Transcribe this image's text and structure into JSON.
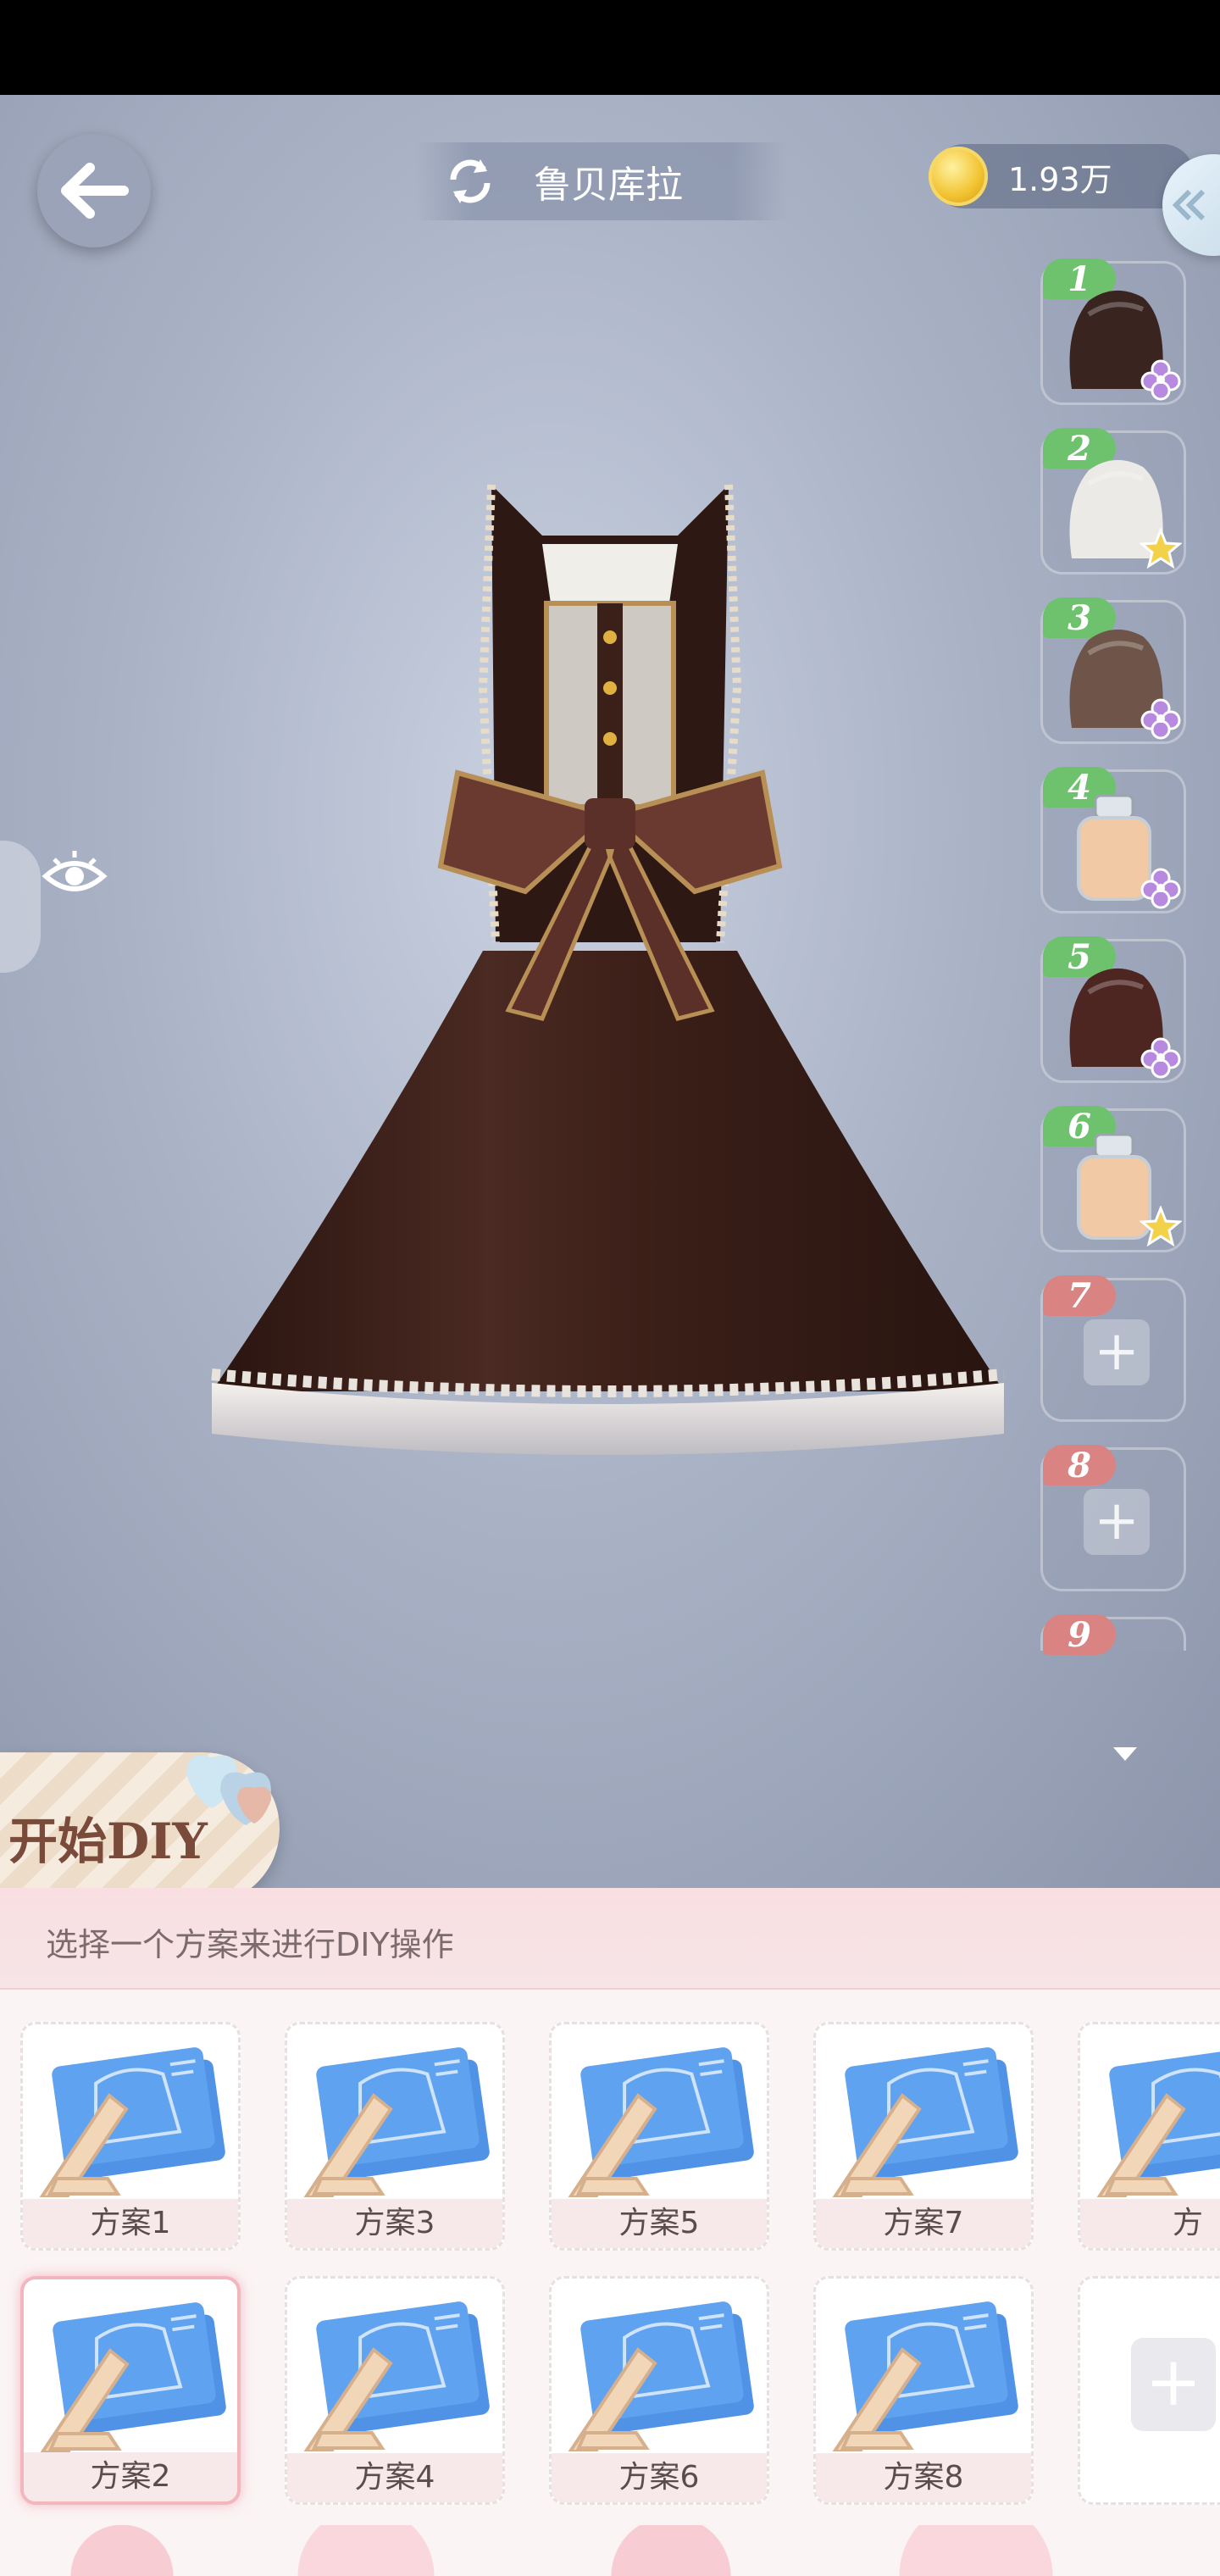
{
  "header": {
    "title": "鲁贝库拉",
    "currency_value": "1.93万"
  },
  "slots": [
    {
      "number": "1",
      "state": "filled",
      "item_icon": "hair-dark-brown-icon",
      "rarity": "purple-flower"
    },
    {
      "number": "2",
      "state": "filled",
      "item_icon": "hair-white-sparkle-icon",
      "rarity": "gold-star"
    },
    {
      "number": "3",
      "state": "filled",
      "item_icon": "hair-taupe-icon",
      "rarity": "purple-flower"
    },
    {
      "number": "4",
      "state": "filled",
      "item_icon": "perfume-bottle-icon",
      "rarity": "purple-flower"
    },
    {
      "number": "5",
      "state": "filled",
      "item_icon": "hair-maroon-icon",
      "rarity": "purple-flower"
    },
    {
      "number": "6",
      "state": "filled",
      "item_icon": "perfume-bottle-icon",
      "rarity": "gold-star"
    },
    {
      "number": "7",
      "state": "empty"
    },
    {
      "number": "8",
      "state": "empty"
    },
    {
      "number": "9",
      "state": "empty"
    }
  ],
  "diy_button": {
    "label": "开始DIY"
  },
  "plans_panel": {
    "hint": "选择一个方案来进行DIY操作",
    "row1": [
      "方案1",
      "方案3",
      "方案5",
      "方案7",
      "方"
    ],
    "row2": [
      "方案2",
      "方案4",
      "方案6",
      "方案8"
    ],
    "selected": "方案2"
  },
  "colors": {
    "slot_filled_badge": "#6ec26e",
    "slot_empty_badge": "#d98383",
    "panel_header": "#f9dfe2",
    "selected_card_border": "#f2b6bf"
  }
}
